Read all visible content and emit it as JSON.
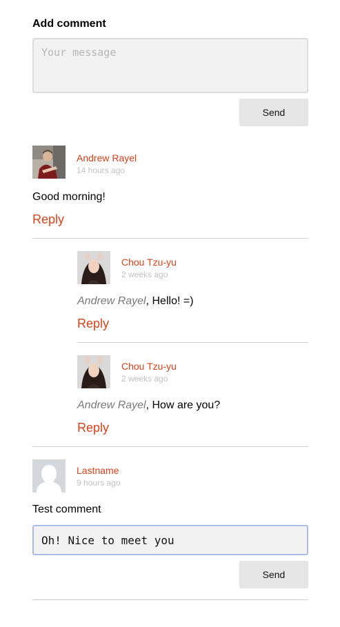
{
  "header": {
    "title": "Add comment"
  },
  "form": {
    "placeholder": "Your message",
    "send_label": "Send"
  },
  "comments": [
    {
      "author": "Andrew Rayel",
      "time": "14 hours ago",
      "text": "Good morning!",
      "reply_label": "Reply",
      "replies": [
        {
          "author": "Chou Tzu-yu",
          "time": "2 weeks ago",
          "mention": "Andrew Rayel",
          "text": ", Hello! =)",
          "reply_label": "Reply"
        },
        {
          "author": "Chou Tzu-yu",
          "time": "2 weeks ago",
          "mention": "Andrew Rayel",
          "text": ", How are you?",
          "reply_label": "Reply"
        }
      ]
    },
    {
      "author": "Lastname",
      "time": "9 hours ago",
      "text": "Test comment",
      "reply_form": {
        "value": "Oh! Nice to meet you",
        "send_label": "Send"
      }
    }
  ],
  "colors": {
    "accent": "#d9421b",
    "muted": "#c3c3c3",
    "mention": "#7a7a7a",
    "button_bg": "#e6e6e6",
    "focus_border": "#a9bde8"
  }
}
